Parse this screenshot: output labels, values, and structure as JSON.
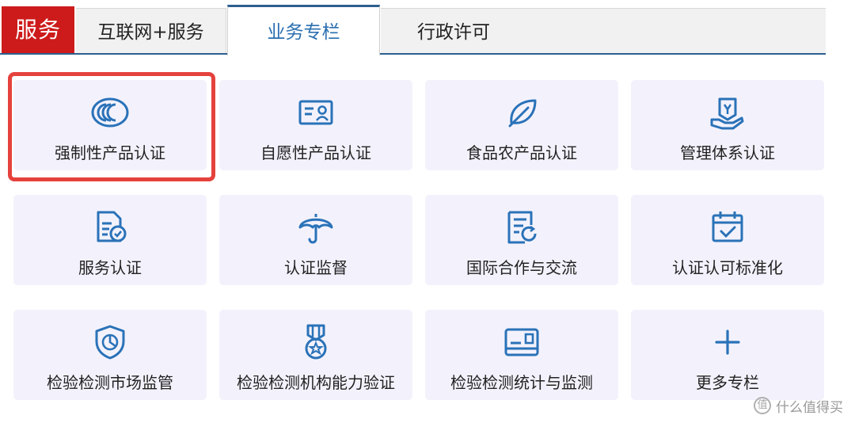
{
  "tabs": {
    "brand": "服务",
    "items": [
      {
        "label": "互联网+服务"
      },
      {
        "label": "业务专栏",
        "active": true
      },
      {
        "label": "行政许可"
      }
    ]
  },
  "colors": {
    "brand_red": "#cd1b1b",
    "icon_blue": "#2a72b8",
    "active_tab_text": "#2a6fb0",
    "highlight_red": "#e5423d",
    "card_bg": "#f3f2fc"
  },
  "grid": [
    {
      "label": "强制性产品认证",
      "icon": "ccc-mark-icon",
      "highlighted": true
    },
    {
      "label": "自愿性产品认证",
      "icon": "id-card-icon"
    },
    {
      "label": "食品农产品认证",
      "icon": "leaf-icon"
    },
    {
      "label": "管理体系认证",
      "icon": "certificate-hand-icon"
    },
    {
      "label": "服务认证",
      "icon": "document-check-icon"
    },
    {
      "label": "认证监督",
      "icon": "umbrella-icon"
    },
    {
      "label": "国际合作与交流",
      "icon": "document-refresh-icon"
    },
    {
      "label": "认证认可标准化",
      "icon": "calendar-check-icon"
    },
    {
      "label": "检验检测市场监管",
      "icon": "shield-chart-icon"
    },
    {
      "label": "检验检测机构能力验证",
      "icon": "medal-icon"
    },
    {
      "label": "检验检测统计与监测",
      "icon": "card-stats-icon"
    },
    {
      "label": "更多专栏",
      "icon": "plus-icon"
    }
  ],
  "watermark": {
    "badge": "值",
    "text": "什么值得买"
  }
}
